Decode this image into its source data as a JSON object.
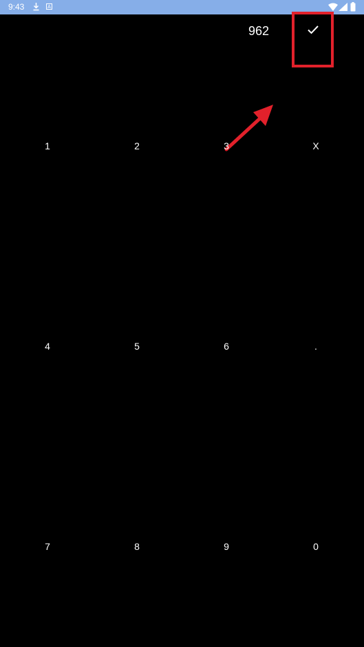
{
  "status_bar": {
    "time": "9:43",
    "icons": [
      "download-icon",
      "a-badge-icon",
      "wifi-icon",
      "signal-icon",
      "battery-icon"
    ],
    "background": "#86aee8"
  },
  "header": {
    "amount": "962",
    "confirm_icon": "checkmark-icon"
  },
  "annotation": {
    "highlight_color": "#e2212b",
    "arrow_icon": "arrow-icon"
  },
  "keypad": {
    "rows": [
      [
        "1",
        "2",
        "3",
        "X"
      ],
      [
        "4",
        "5",
        "6",
        "."
      ],
      [
        "7",
        "8",
        "9",
        "0"
      ]
    ]
  }
}
